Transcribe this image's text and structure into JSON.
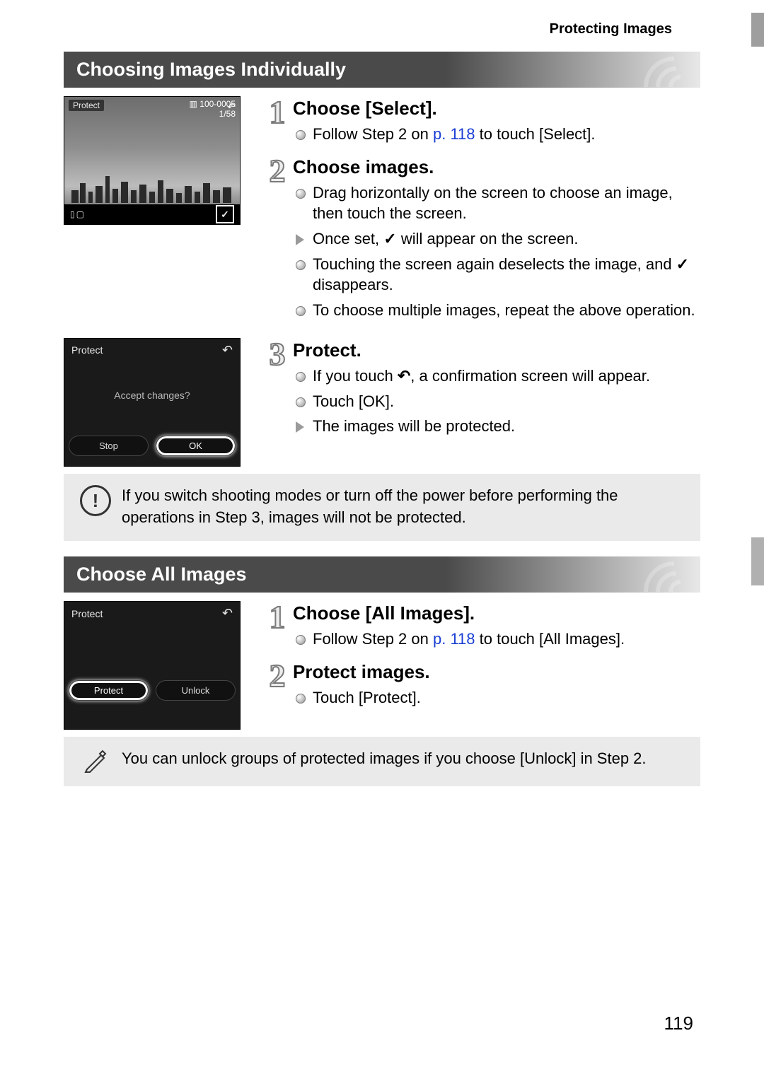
{
  "running_head": "Protecting Images",
  "page_number": "119",
  "section1": {
    "title": "Choosing Images Individually",
    "screenshot1": {
      "protect_label": "Protect",
      "counter_top": "100-0005",
      "counter_bottom": "1/58"
    },
    "screenshot2": {
      "protect_label": "Protect",
      "message": "Accept changes?",
      "btn_left": "Stop",
      "btn_right": "OK"
    },
    "step1": {
      "num": "1",
      "title": "Choose [Select].",
      "b1a": "Follow Step 2 on ",
      "b1link": "p. 118",
      "b1b": " to touch [Select]."
    },
    "step2": {
      "num": "2",
      "title": "Choose images.",
      "b1": "Drag horizontally on the screen to choose an image, then touch the screen.",
      "b2a": "Once set, ",
      "b2b": " will appear on the screen.",
      "b3a": "Touching the screen again deselects the image, and ",
      "b3b": " disappears.",
      "b4": "To choose multiple images, repeat the above operation."
    },
    "step3": {
      "num": "3",
      "title": "Protect.",
      "b1a": "If you touch ",
      "b1b": ", a confirmation screen will appear.",
      "b2": "Touch [OK].",
      "b3": "The images will be protected."
    },
    "warning": "If you switch shooting modes or turn off the power before performing the operations in Step 3, images will not be protected."
  },
  "section2": {
    "title": "Choose All Images",
    "screenshot": {
      "protect_label": "Protect",
      "btn_left": "Protect",
      "btn_right": "Unlock"
    },
    "step1": {
      "num": "1",
      "title": "Choose [All Images].",
      "b1a": "Follow Step 2 on ",
      "b1link": "p. 118",
      "b1b": " to touch [All Images]."
    },
    "step2": {
      "num": "2",
      "title": "Protect images.",
      "b1": "Touch [Protect]."
    },
    "tip": "You can unlock groups of protected images if you choose [Unlock] in Step 2."
  }
}
